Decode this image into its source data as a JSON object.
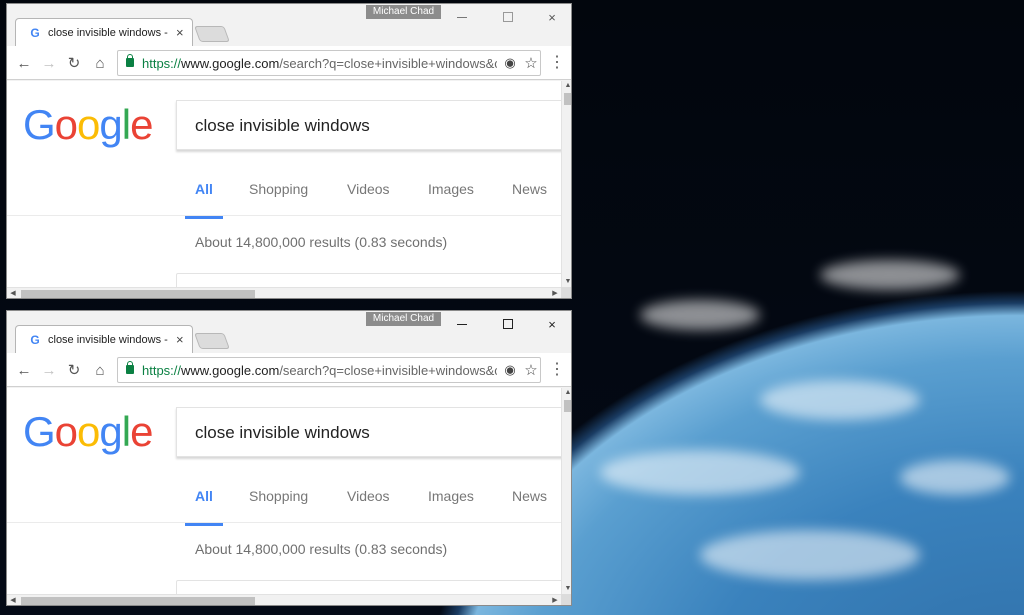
{
  "windows": [
    {
      "user_badge": "Michael Chad",
      "tab": {
        "title": "close invisible windows -",
        "favicon": "G",
        "close_glyph": "×"
      },
      "toolbar": {
        "back_glyph": "←",
        "forward_glyph": "→",
        "reload_glyph": "↻",
        "home_glyph": "⌂",
        "url_scheme": "https://",
        "url_host": "www.google.com",
        "url_path": "/search?q=close+invisible+windows&c",
        "location_glyph": "◉",
        "star_glyph": "☆",
        "menu_glyph": "⋮"
      },
      "page": {
        "logo": [
          "G",
          "o",
          "o",
          "g",
          "l",
          "e"
        ],
        "search_query": "close invisible windows",
        "tabs": [
          "All",
          "Shopping",
          "Videos",
          "Images",
          "News"
        ],
        "active_tab": "All",
        "results_stats": "About 14,800,000 results (0.83 seconds)"
      }
    },
    {
      "user_badge": "Michael Chad",
      "tab": {
        "title": "close invisible windows -",
        "favicon": "G",
        "close_glyph": "×"
      },
      "toolbar": {
        "back_glyph": "←",
        "forward_glyph": "→",
        "reload_glyph": "↻",
        "home_glyph": "⌂",
        "url_scheme": "https://",
        "url_host": "www.google.com",
        "url_path": "/search?q=close+invisible+windows&c",
        "location_glyph": "◉",
        "star_glyph": "☆",
        "menu_glyph": "⋮"
      },
      "page": {
        "logo": [
          "G",
          "o",
          "o",
          "g",
          "l",
          "e"
        ],
        "search_query": "close invisible windows",
        "tabs": [
          "All",
          "Shopping",
          "Videos",
          "Images",
          "News"
        ],
        "active_tab": "All",
        "results_stats": "About 14,800,000 results (0.83 seconds)"
      }
    }
  ],
  "colors": {
    "google_blue": "#4285f4",
    "google_red": "#ea4335",
    "google_yellow": "#fbbc05",
    "google_green": "#34a853",
    "secure_green": "#0b8043"
  },
  "icons": {
    "window_controls": [
      "minimize-icon",
      "maximize-icon",
      "close-icon"
    ],
    "toolbar": [
      "back-arrow-icon",
      "forward-arrow-icon",
      "reload-icon",
      "home-icon",
      "lock-icon",
      "location-icon",
      "star-icon",
      "menu-dots-icon"
    ]
  }
}
